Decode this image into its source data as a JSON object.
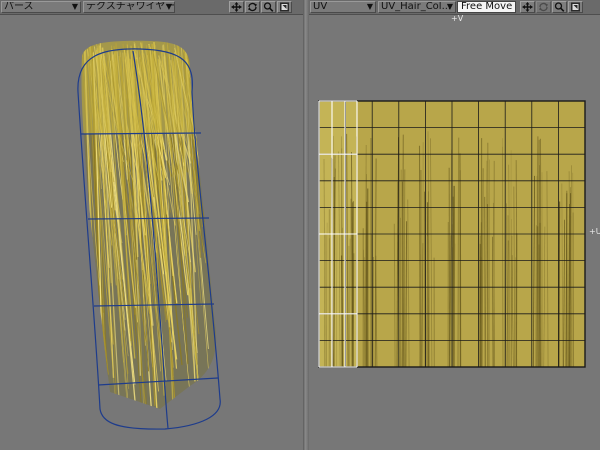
{
  "left_view": {
    "view_mode": "パース",
    "render_mode": "テクスチャワイヤー"
  },
  "right_view": {
    "view_mode": "UV",
    "uv_map": "UV_Hair_Col...",
    "tool_mode": "Free Move",
    "axis_v_label": "+V",
    "axis_u_label": "+U"
  },
  "icons": [
    "move-view-icon",
    "rotate-view-icon",
    "zoom-view-icon",
    "maximize-view-icon"
  ],
  "colors": {
    "background": "#777777",
    "hair": "#c8b440",
    "uv_texture": "#b8a64a",
    "wireframe": "#1e3c8c",
    "uv_grid": "#1a1a1a",
    "selected_edge": "#ffffff"
  }
}
